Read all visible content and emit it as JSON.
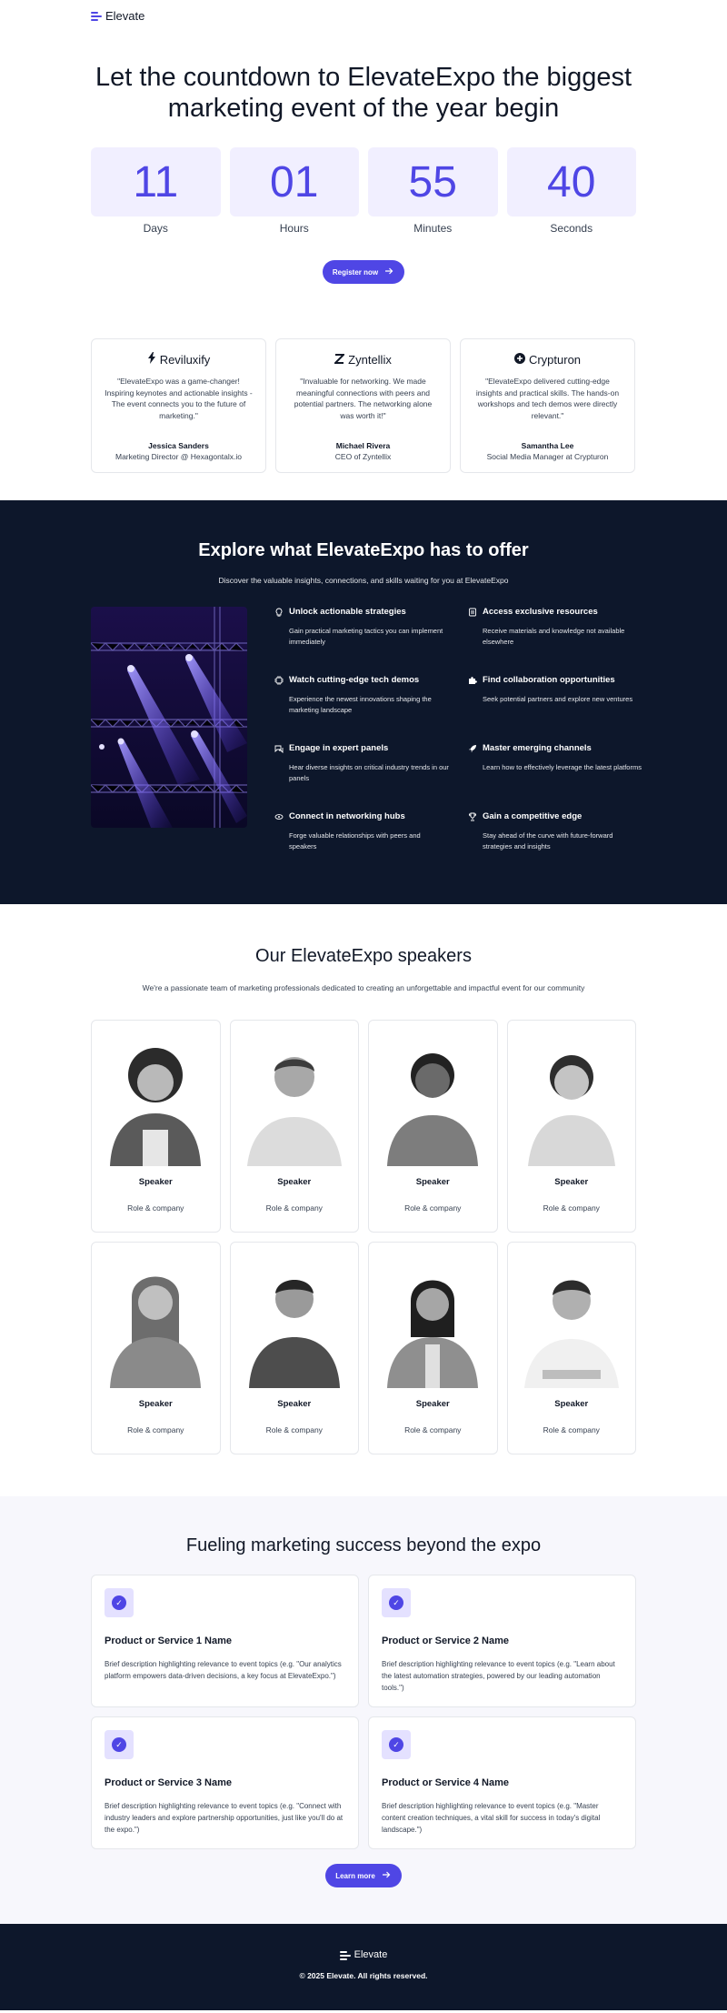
{
  "brand": {
    "name": "Elevate"
  },
  "hero": {
    "title": "Let the countdown to ElevateExpo the biggest marketing event of the year begin"
  },
  "countdown": [
    {
      "value": "11",
      "label": "Days"
    },
    {
      "value": "01",
      "label": "Hours"
    },
    {
      "value": "55",
      "label": "Minutes"
    },
    {
      "value": "40",
      "label": "Seconds"
    }
  ],
  "register_button": {
    "label": "Register now",
    "icon": "arrow-right-icon"
  },
  "testimonials": [
    {
      "company": "Reviluxify",
      "icon": "bolt-icon",
      "quote": "\"ElevateExpo was a game-changer! Inspiring keynotes and actionable insights - The event connects you to the future of marketing.\"",
      "name": "Jessica Sanders",
      "role": "Marketing Director @ Hexagontalx.io"
    },
    {
      "company": "Zyntellix",
      "icon": "z-logo-icon",
      "quote": "\"Invaluable for networking. We made meaningful connections with peers and potential partners. The networking alone was worth it!\"",
      "name": "Michael Rivera",
      "role": "CEO of Zyntellix"
    },
    {
      "company": "Crypturon",
      "icon": "plus-circle-icon",
      "quote": "\"ElevateExpo delivered cutting-edge insights and practical skills. The hands-on workshops and tech demos were directly relevant.\"",
      "name": "Samantha Lee",
      "role": "Social Media Manager at Crypturon"
    }
  ],
  "offer": {
    "title": "Explore what ElevateExpo has to offer",
    "subtitle": "Discover the valuable insights, connections, and skills waiting for you at ElevateExpo",
    "features": [
      {
        "title": "Unlock actionable strategies",
        "desc": "Gain practical marketing tactics you can implement immediately",
        "icon": "lightbulb-icon"
      },
      {
        "title": "Access exclusive resources",
        "desc": "Receive materials and knowledge not available elsewhere",
        "icon": "document-icon"
      },
      {
        "title": "Watch cutting-edge tech demos",
        "desc": "Experience the newest innovations shaping the marketing landscape",
        "icon": "chip-icon"
      },
      {
        "title": "Find collaboration opportunities",
        "desc": "Seek potential partners and explore new ventures",
        "icon": "puzzle-icon"
      },
      {
        "title": "Engage in expert panels",
        "desc": "Hear diverse insights on critical industry trends in our panels",
        "icon": "chat-icon"
      },
      {
        "title": "Master emerging channels",
        "desc": "Learn how to effectively leverage the latest platforms",
        "icon": "rocket-icon"
      },
      {
        "title": "Connect in networking hubs",
        "desc": "Forge valuable relationships with peers and speakers",
        "icon": "link-icon"
      },
      {
        "title": "Gain a competitive edge",
        "desc": "Stay ahead of the curve with future-forward strategies and insights",
        "icon": "trophy-icon"
      }
    ]
  },
  "speakers": {
    "title": "Our ElevateExpo speakers",
    "subtitle": "We're a passionate team of marketing professionals dedicated to creating an unforgettable and impactful event for our community",
    "items": [
      {
        "name": "Speaker",
        "role": "Role & company"
      },
      {
        "name": "Speaker",
        "role": "Role & company"
      },
      {
        "name": "Speaker",
        "role": "Role & company"
      },
      {
        "name": "Speaker",
        "role": "Role & company"
      },
      {
        "name": "Speaker",
        "role": "Role & company"
      },
      {
        "name": "Speaker",
        "role": "Role & company"
      },
      {
        "name": "Speaker",
        "role": "Role & company"
      },
      {
        "name": "Speaker",
        "role": "Role & company"
      }
    ]
  },
  "products": {
    "title": "Fueling marketing success beyond the expo",
    "items": [
      {
        "title": "Product or Service 1 Name",
        "desc": "Brief description highlighting relevance to event topics (e.g. \"Our analytics platform empowers data-driven decisions, a key focus at ElevateExpo.\")"
      },
      {
        "title": "Product or Service 2 Name",
        "desc": "Brief description highlighting relevance to event topics (e.g. \"Learn about the latest automation strategies, powered by our leading automation tools.\")"
      },
      {
        "title": "Product or Service 3 Name",
        "desc": "Brief description highlighting relevance to event topics (e.g. \"Connect with industry leaders and explore partnership opportunities, just like you'll do at the expo.\")"
      },
      {
        "title": "Product or Service 4 Name",
        "desc": "Brief description highlighting relevance to event topics (e.g. \"Master content creation techniques, a vital skill for success in today's digital landscape.\")"
      }
    ],
    "button": "Learn more"
  },
  "footer": {
    "brand": "Elevate",
    "copyright": "© 2025 Elevate. All rights reserved."
  },
  "colors": {
    "accent": "#4f46e5",
    "dark": "#0d172b",
    "tint": "#f1efff"
  }
}
